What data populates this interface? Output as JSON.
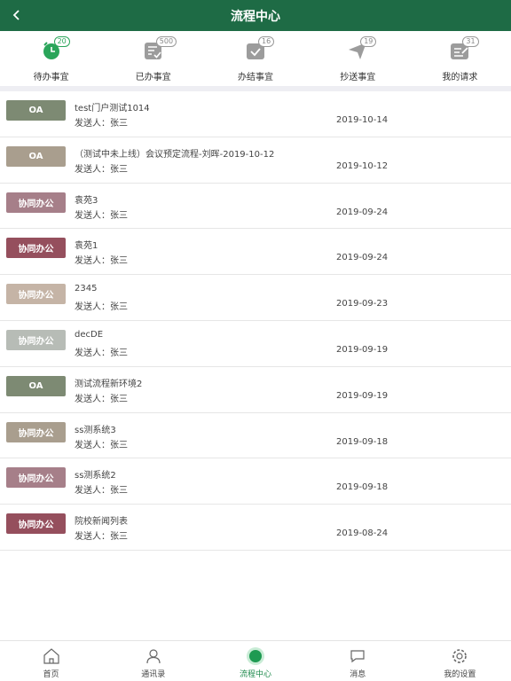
{
  "header": {
    "title": "流程中心"
  },
  "tabs": [
    {
      "label": "待办事宜",
      "badge": "20",
      "icon": "alarm-clock-icon",
      "active": true
    },
    {
      "label": "已办事宜",
      "badge": "500",
      "icon": "done-list-icon"
    },
    {
      "label": "办结事宜",
      "badge": "16",
      "icon": "check-box-icon"
    },
    {
      "label": "抄送事宜",
      "badge": "19",
      "icon": "paper-plane-icon"
    },
    {
      "label": "我的请求",
      "badge": "31",
      "icon": "edit-document-icon"
    }
  ],
  "rows": [
    {
      "tag": "OA",
      "tag_color": "#7d8a73",
      "title": "test门户测试1014",
      "sender": "发送人：张三",
      "date": "2019-10-14"
    },
    {
      "tag": "OA",
      "tag_color": "#a99e8e",
      "title": "（测试中未上线）会议预定流程-刘晖-2019-10-12",
      "sender": "发送人：张三",
      "date": "2019-10-12"
    },
    {
      "tag": "协同办公",
      "tag_color": "#a67f89",
      "title": "袁苑3",
      "sender": "发送人：张三",
      "date": "2019-09-24"
    },
    {
      "tag": "协同办公",
      "tag_color": "#954f5d",
      "title": "袁苑1",
      "sender": "发送人：张三",
      "date": "2019-09-24"
    },
    {
      "tag": "协同办公",
      "tag_color": "#c5b4a6",
      "title": "2345",
      "sender": "发送人：张三",
      "date": "2019-09-23"
    },
    {
      "tag": "协同办公",
      "tag_color": "#b7bcb6",
      "title": "decDE",
      "sender": "发送人：张三",
      "date": "2019-09-19"
    },
    {
      "tag": "OA",
      "tag_color": "#7d8a73",
      "title": "测试流程新环境2",
      "sender": "发送人：张三",
      "date": "2019-09-19"
    },
    {
      "tag": "协同办公",
      "tag_color": "#a99e8e",
      "title": "ss测系统3",
      "sender": "发送人：张三",
      "date": "2019-09-18"
    },
    {
      "tag": "协同办公",
      "tag_color": "#a67f89",
      "title": "ss测系统2",
      "sender": "发送人：张三",
      "date": "2019-09-18"
    },
    {
      "tag": "协同办公",
      "tag_color": "#954f5d",
      "title": "院校新闻列表",
      "sender": "发送人：张三",
      "date": "2019-08-24"
    }
  ],
  "bottom_nav": [
    {
      "label": "首页",
      "icon": "home-icon"
    },
    {
      "label": "通讯录",
      "icon": "contacts-icon"
    },
    {
      "label": "流程中心",
      "icon": "process-center-icon",
      "active": true
    },
    {
      "label": "消息",
      "icon": "message-icon"
    },
    {
      "label": "我的设置",
      "icon": "settings-gear-icon"
    }
  ],
  "colors": {
    "header": "#1e6b45",
    "accent": "#2aa55a"
  }
}
